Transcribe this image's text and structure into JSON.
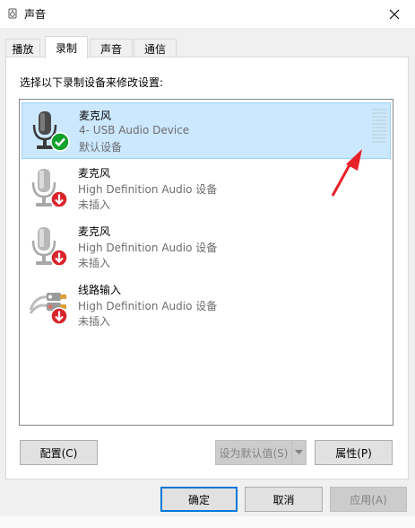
{
  "window": {
    "title": "声音"
  },
  "tabs": [
    {
      "label": "播放"
    },
    {
      "label": "录制"
    },
    {
      "label": "声音"
    },
    {
      "label": "通信"
    }
  ],
  "panel": {
    "instruction": "选择以下录制设备来修改设置:"
  },
  "devices": [
    {
      "name": "麦克风",
      "description": "4- USB Audio Device",
      "status": "默认设备",
      "icon": "microphone-icon",
      "badge": "default-check-icon",
      "selected": true
    },
    {
      "name": "麦克风",
      "description": "High Definition Audio 设备",
      "status": "未插入",
      "icon": "microphone-icon",
      "badge": "unplugged-arrow-icon",
      "selected": false
    },
    {
      "name": "麦克风",
      "description": "High Definition Audio 设备",
      "status": "未插入",
      "icon": "microphone-icon",
      "badge": "unplugged-arrow-icon",
      "selected": false
    },
    {
      "name": "线路输入",
      "description": "High Definition Audio 设备",
      "status": "未插入",
      "icon": "line-in-cable-icon",
      "badge": "unplugged-arrow-icon",
      "selected": false
    }
  ],
  "buttons": {
    "configure": "配置(C)",
    "set_default": "设为默认值(S)",
    "properties": "属性(P)",
    "ok": "确定",
    "cancel": "取消",
    "apply": "应用(A)"
  },
  "colors": {
    "selection_bg": "#cce8ff",
    "default_check": "#12a12a",
    "unplugged_badge": "#d9252b",
    "annotation_arrow": "#e8202a",
    "focus_border": "#0078d7"
  }
}
